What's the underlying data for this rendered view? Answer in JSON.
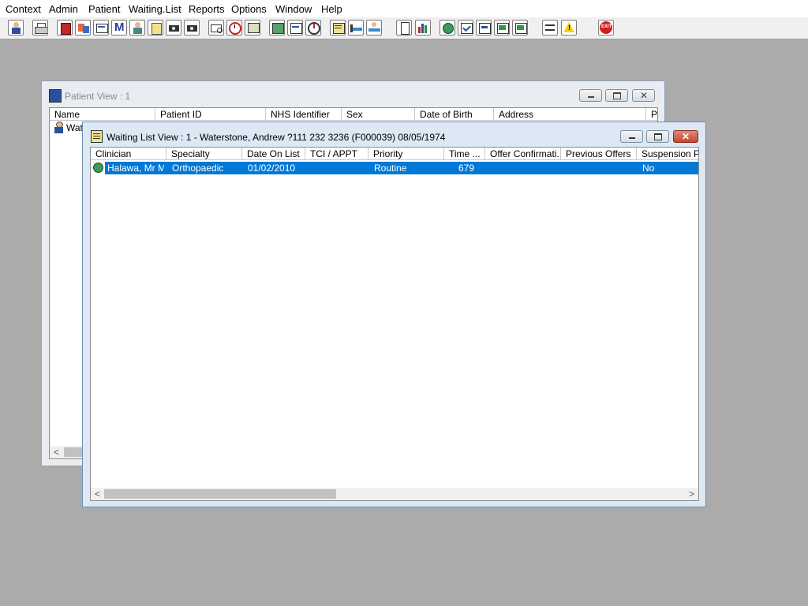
{
  "menu": [
    "Context",
    "Admin",
    "Patient",
    "Waiting.List",
    "Reports",
    "Options",
    "Window",
    "Help"
  ],
  "toolbar_buttons": [
    {
      "icon": "patient-icon"
    },
    {
      "icon": "printer-icon"
    },
    {
      "icon": "red-book-icon"
    },
    {
      "icon": "transfer-icon"
    },
    {
      "icon": "letters-icon"
    },
    {
      "icon": "m-icon"
    },
    {
      "icon": "doctor-icon"
    },
    {
      "icon": "notepad-icon"
    },
    {
      "icon": "camera-icon"
    },
    {
      "icon": "camera2-icon"
    },
    {
      "icon": "envelope-search-icon"
    },
    {
      "icon": "clock-icon"
    },
    {
      "icon": "screen-icon"
    },
    {
      "icon": "photo-icon"
    },
    {
      "icon": "edit-form-icon"
    },
    {
      "icon": "gauge-icon"
    },
    {
      "icon": "list-icon"
    },
    {
      "icon": "bed-icon"
    },
    {
      "icon": "patient-bed-icon"
    },
    {
      "icon": "document-icon"
    },
    {
      "icon": "bar-chart-icon"
    },
    {
      "icon": "globe-icon"
    },
    {
      "icon": "check-form-icon"
    },
    {
      "icon": "forward-form-icon"
    },
    {
      "icon": "green-arrow-form-icon"
    },
    {
      "icon": "refresh-form-icon"
    },
    {
      "icon": "swap-icon"
    },
    {
      "icon": "warning-icon"
    },
    {
      "icon": "exit-icon",
      "label": "EXIT"
    }
  ],
  "patient_view": {
    "title": "Patient View : 1",
    "columns": [
      "Name",
      "Patient ID",
      "NHS Identifier",
      "Sex",
      "Date of Birth",
      "Address",
      "Po"
    ],
    "rows": [
      {
        "name": "Wate"
      }
    ],
    "scroll_left": "<"
  },
  "waiting_list_view": {
    "title": "Waiting List View :  1 - Waterstone, Andrew ?111 232 3236 (F000039) 08/05/1974",
    "columns": [
      "Clinician",
      "Specialty",
      "Date On List",
      "TCI / APPT",
      "Priority",
      "Time ...",
      "Offer Confirmati...",
      "Previous Offers",
      "Suspension Pe"
    ],
    "rows": [
      {
        "clinician": "Halawa, Mr M",
        "specialty": "Orthopaedic",
        "date_on_list": "01/02/2010",
        "tci_appt": "",
        "priority": "Routine",
        "time": "679",
        "offer_confirmation": "",
        "previous_offers": "",
        "suspension": "No"
      }
    ],
    "scroll_left": "<",
    "scroll_right": ">"
  },
  "colors": {
    "desktop": "#ababab",
    "selection": "#0078d7",
    "close_button": "#c9452f",
    "active_frame": "#dce8f4",
    "inactive_frame": "#e9edf2"
  }
}
